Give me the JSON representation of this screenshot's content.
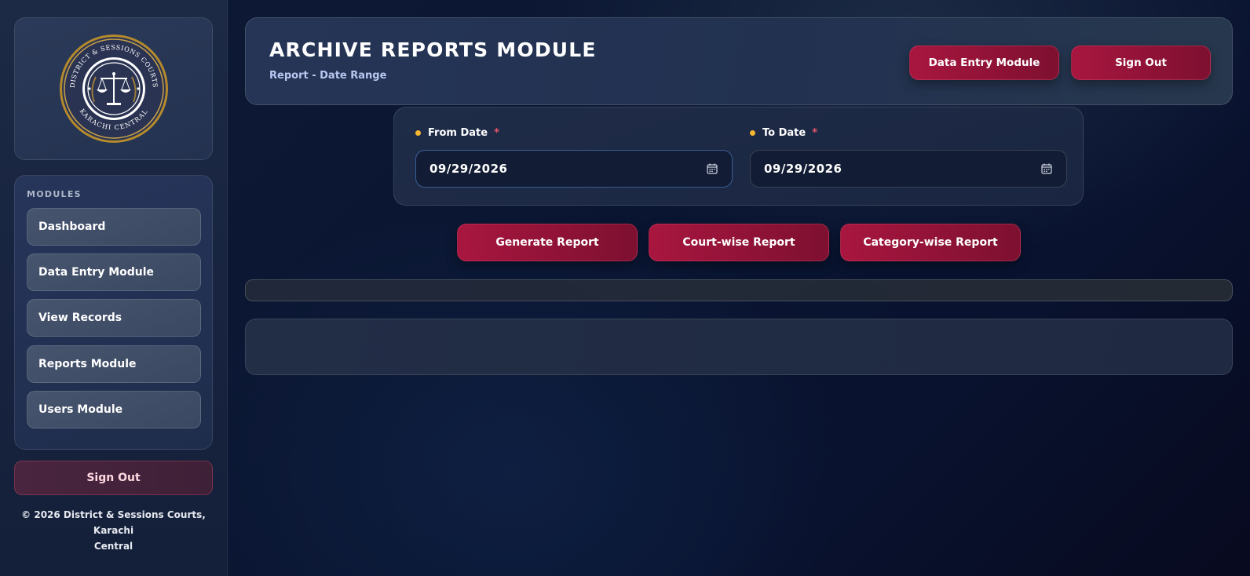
{
  "sidebar": {
    "logo": {
      "outer_text_top": "DISTRICT & SESSIONS COURTS",
      "outer_text_bottom": "KARACHI CENTRAL"
    },
    "modules_title": "MODULES",
    "items": [
      {
        "label": "Dashboard"
      },
      {
        "label": "Data Entry Module"
      },
      {
        "label": "View Records"
      },
      {
        "label": "Reports Module"
      },
      {
        "label": "Users Module"
      }
    ],
    "signout_label": "Sign Out",
    "copyright_line1": "© 2026 District & Sessions Courts, Karachi",
    "copyright_line2": "Central"
  },
  "header": {
    "title": "ARCHIVE REPORTS MODULE",
    "subtitle": "Report - Date Range",
    "data_entry_label": "Data Entry Module",
    "signout_label": "Sign Out"
  },
  "form": {
    "from_label": "From Date",
    "from_value": "09/29/2026",
    "to_label": "To Date",
    "to_value": "09/29/2026",
    "required_mark": "*"
  },
  "actions": {
    "generate_label": "Generate Report",
    "court_label": "Court-wise Report",
    "category_label": "Category-wise Report"
  },
  "colors": {
    "accent_red": "#a8163f",
    "accent_red_dark": "#7d1030",
    "dot_yellow": "#f5b731",
    "required_red": "#e8566b",
    "subtitle_blue": "#b8c8f2"
  },
  "icons": {
    "date_picker": "calendar-icon",
    "logo": "court-seal-logo"
  }
}
